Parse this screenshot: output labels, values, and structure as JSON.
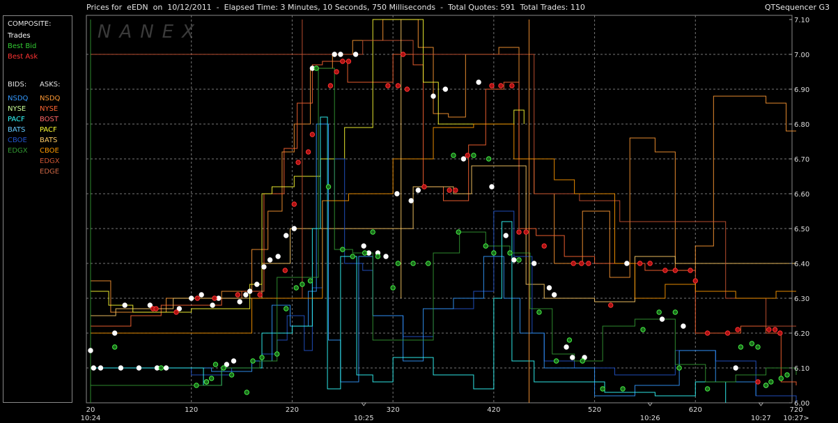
{
  "header": {
    "title": "Prices for  eEDN  on  10/12/2011  -  Elapsed Time: 3 Minutes, 10 Seconds, 750 Milliseconds  -  Total Quotes: 591  Total Trades: 110",
    "brand": "QTSequencer G3"
  },
  "watermark": "NANEX",
  "legend": {
    "composite_label": "COMPOSITE:",
    "composite": [
      {
        "label": "Trades",
        "color": "#ffffff"
      },
      {
        "label": "Best Bid",
        "color": "#33cc33"
      },
      {
        "label": "Best Ask",
        "color": "#ff3333"
      }
    ],
    "bids_label": "BIDS:",
    "asks_label": "ASKS:",
    "bids": [
      {
        "label": "NSDQ",
        "color": "#3399ff"
      },
      {
        "label": "NYSE",
        "color": "#ccff99"
      },
      {
        "label": "PACF",
        "color": "#33ffff"
      },
      {
        "label": "BATS",
        "color": "#66ccff"
      },
      {
        "label": "CBOE",
        "color": "#2255cc"
      },
      {
        "label": "EDGX",
        "color": "#339933"
      }
    ],
    "asks": [
      {
        "label": "NSDQ",
        "color": "#ff9933"
      },
      {
        "label": "NYSE",
        "color": "#ff6633"
      },
      {
        "label": "BOST",
        "color": "#ff6666"
      },
      {
        "label": "PACF",
        "color": "#ffff33"
      },
      {
        "label": "BATS",
        "color": "#ffcc66"
      },
      {
        "label": "CBOE",
        "color": "#ff9900"
      },
      {
        "label": "EDGX",
        "color": "#cc5533"
      },
      {
        "label": "EDGE",
        "color": "#cc6644"
      }
    ]
  },
  "chart_data": {
    "type": "line",
    "x_ticks": [
      20,
      120,
      220,
      320,
      420,
      520,
      620,
      720
    ],
    "time_labels": [
      {
        "at": 20,
        "label": "10:24"
      },
      {
        "at": 291,
        "label": "10:25"
      },
      {
        "at": 575,
        "label": "10:26"
      },
      {
        "at": 685,
        "label": "10:27"
      },
      {
        "at": 720,
        "label": "10:27>"
      }
    ],
    "xlim": [
      20,
      720
    ],
    "ylim": [
      6.0,
      7.1
    ],
    "y_ticks": [
      "6.00",
      "6.10",
      "6.20",
      "6.30",
      "6.40",
      "6.50",
      "6.60",
      "6.70",
      "6.80",
      "6.90",
      "7.00",
      "7.10"
    ],
    "grid": true,
    "series": [
      {
        "name": "Trades",
        "marker": "white",
        "values": [
          [
            20,
            6.15
          ],
          [
            23,
            6.1
          ],
          [
            30,
            6.1
          ],
          [
            44,
            6.2
          ],
          [
            50,
            6.1
          ],
          [
            54,
            6.28
          ],
          [
            68,
            6.1
          ],
          [
            79,
            6.28
          ],
          [
            86,
            6.1
          ],
          [
            95,
            6.1
          ],
          [
            108,
            6.27
          ],
          [
            120,
            6.3
          ],
          [
            130,
            6.31
          ],
          [
            135,
            6.06
          ],
          [
            141,
            6.28
          ],
          [
            147,
            6.3
          ],
          [
            155,
            6.11
          ],
          [
            162,
            6.12
          ],
          [
            168,
            6.29
          ],
          [
            174,
            6.31
          ],
          [
            178,
            6.32
          ],
          [
            185,
            6.34
          ],
          [
            192,
            6.39
          ],
          [
            198,
            6.41
          ],
          [
            206,
            6.42
          ],
          [
            214,
            6.48
          ],
          [
            222,
            6.5
          ],
          [
            240,
            6.96
          ],
          [
            262,
            7.0
          ],
          [
            268,
            7.0
          ],
          [
            283,
            7.0
          ],
          [
            291,
            6.45
          ],
          [
            296,
            6.43
          ],
          [
            305,
            6.43
          ],
          [
            313,
            6.42
          ],
          [
            324,
            6.6
          ],
          [
            338,
            6.58
          ],
          [
            345,
            6.61
          ],
          [
            360,
            6.88
          ],
          [
            372,
            6.9
          ],
          [
            390,
            6.7
          ],
          [
            405,
            6.92
          ],
          [
            418,
            6.62
          ],
          [
            432,
            6.48
          ],
          [
            440,
            6.41
          ],
          [
            460,
            6.4
          ],
          [
            475,
            6.33
          ],
          [
            480,
            6.31
          ],
          [
            492,
            6.16
          ],
          [
            498,
            6.13
          ],
          [
            510,
            6.13
          ],
          [
            552,
            6.4
          ],
          [
            587,
            6.24
          ],
          [
            608,
            6.22
          ],
          [
            660,
            6.1
          ],
          [
            690,
            6.05
          ]
        ]
      },
      {
        "name": "Best Bid",
        "marker": "green",
        "values": [
          [
            44,
            6.16
          ],
          [
            90,
            6.1
          ],
          [
            125,
            6.05
          ],
          [
            135,
            6.06
          ],
          [
            140,
            6.07
          ],
          [
            144,
            6.11
          ],
          [
            152,
            6.1
          ],
          [
            160,
            6.08
          ],
          [
            175,
            6.03
          ],
          [
            181,
            6.12
          ],
          [
            190,
            6.13
          ],
          [
            205,
            6.14
          ],
          [
            214,
            6.27
          ],
          [
            224,
            6.33
          ],
          [
            230,
            6.34
          ],
          [
            238,
            6.35
          ],
          [
            244,
            6.96
          ],
          [
            256,
            6.62
          ],
          [
            270,
            6.44
          ],
          [
            280,
            6.42
          ],
          [
            292,
            6.43
          ],
          [
            305,
            6.42
          ],
          [
            320,
            6.33
          ],
          [
            325,
            6.4
          ],
          [
            340,
            6.4
          ],
          [
            355,
            6.4
          ],
          [
            380,
            6.71
          ],
          [
            400,
            6.71
          ],
          [
            415,
            6.7
          ],
          [
            300,
            6.49
          ],
          [
            385,
            6.49
          ],
          [
            412,
            6.45
          ],
          [
            420,
            6.43
          ],
          [
            436,
            6.43
          ],
          [
            445,
            6.41
          ],
          [
            465,
            6.26
          ],
          [
            482,
            6.12
          ],
          [
            495,
            6.18
          ],
          [
            508,
            6.12
          ],
          [
            528,
            6.04
          ],
          [
            548,
            6.04
          ],
          [
            568,
            6.21
          ],
          [
            584,
            6.26
          ],
          [
            600,
            6.26
          ],
          [
            604,
            6.1
          ],
          [
            632,
            6.04
          ],
          [
            665,
            6.16
          ],
          [
            676,
            6.17
          ],
          [
            682,
            6.16
          ],
          [
            690,
            6.05
          ],
          [
            695,
            6.06
          ],
          [
            705,
            6.07
          ],
          [
            711,
            6.08
          ]
        ]
      },
      {
        "name": "Best Ask",
        "marker": "red",
        "values": [
          [
            82,
            6.27
          ],
          [
            85,
            6.27
          ],
          [
            105,
            6.26
          ],
          [
            126,
            6.3
          ],
          [
            143,
            6.3
          ],
          [
            166,
            6.31
          ],
          [
            188,
            6.31
          ],
          [
            213,
            6.38
          ],
          [
            222,
            6.57
          ],
          [
            226,
            6.69
          ],
          [
            236,
            6.72
          ],
          [
            240,
            6.77
          ],
          [
            258,
            6.91
          ],
          [
            264,
            6.95
          ],
          [
            270,
            6.98
          ],
          [
            276,
            6.98
          ],
          [
            315,
            6.91
          ],
          [
            325,
            6.91
          ],
          [
            330,
            7.0
          ],
          [
            334,
            6.9
          ],
          [
            351,
            6.62
          ],
          [
            376,
            6.61
          ],
          [
            382,
            6.61
          ],
          [
            394,
            6.71
          ],
          [
            418,
            6.91
          ],
          [
            427,
            6.91
          ],
          [
            438,
            6.91
          ],
          [
            445,
            6.49
          ],
          [
            452,
            6.49
          ],
          [
            470,
            6.45
          ],
          [
            499,
            6.4
          ],
          [
            507,
            6.4
          ],
          [
            514,
            6.4
          ],
          [
            536,
            6.28
          ],
          [
            565,
            6.4
          ],
          [
            575,
            6.4
          ],
          [
            590,
            6.38
          ],
          [
            600,
            6.38
          ],
          [
            615,
            6.38
          ],
          [
            620,
            6.35
          ],
          [
            632,
            6.2
          ],
          [
            652,
            6.2
          ],
          [
            662,
            6.21
          ],
          [
            682,
            6.06
          ],
          [
            693,
            6.21
          ],
          [
            699,
            6.21
          ],
          [
            704,
            6.2
          ]
        ]
      }
    ]
  }
}
